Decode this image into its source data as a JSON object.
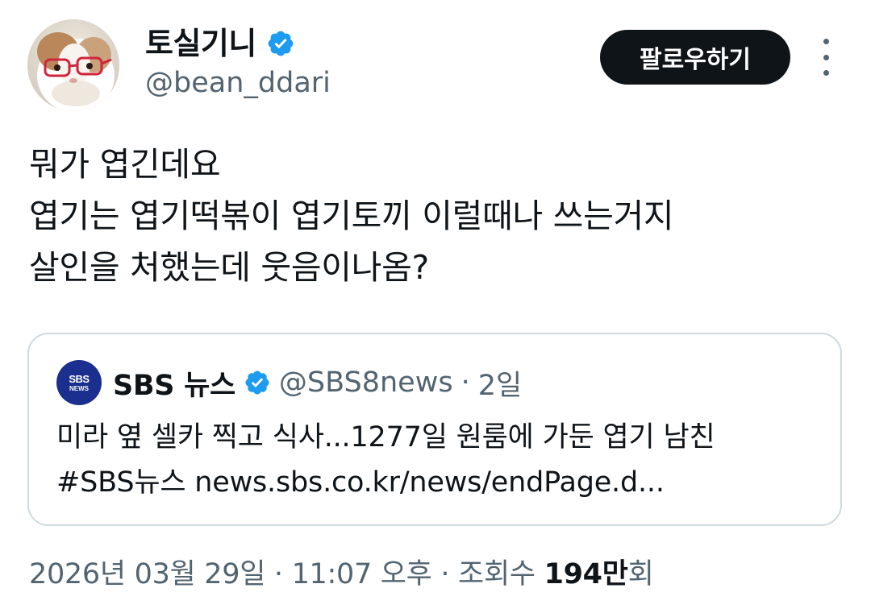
{
  "author": {
    "display_name": "토실기니",
    "handle": "@bean_ddari",
    "verified_color": "#1d9bf0"
  },
  "follow_button": {
    "label": "팔로우하기"
  },
  "more_button": {
    "icon": "more-vertical-icon"
  },
  "tweet": {
    "lines": [
      "뭐가 엽긴데요",
      "엽기는 엽기떡볶이 엽기토끼 이럴때나 쓰는거지",
      "살인을 처했는데 웃음이나옴?"
    ]
  },
  "quote": {
    "logo_line1": "SBS",
    "logo_line2": "NEWS",
    "logo_color": "#1b2f8e",
    "name": "SBS 뉴스",
    "handle": "@SBS8news",
    "separator": "·",
    "time": "2일",
    "lines": [
      "미라 옆 셀카 찍고 식사...1277일 원룸에 가둔 엽기 남친",
      "#SBS뉴스 news.sbs.co.kr/news/endPage.d..."
    ]
  },
  "meta": {
    "date_time": "2026년 03월 29일 · 11:07 오후 · 조회수 ",
    "views_count": "194만",
    "views_suffix": "회"
  }
}
